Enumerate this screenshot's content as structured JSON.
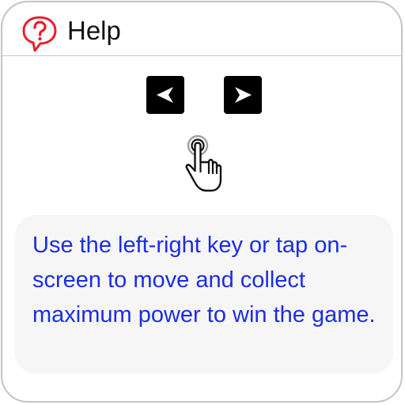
{
  "header": {
    "title": "Help",
    "icon": "question-speech-bubble-icon"
  },
  "controls": {
    "left_key_icon": "arrow-left-icon",
    "right_key_icon": "arrow-right-icon",
    "tap_icon": "tap-hand-icon"
  },
  "info": {
    "text": "Use the left-right key or tap on-screen to move and collect maximum power to win the game."
  },
  "colors": {
    "accent_red": "#e8202a",
    "info_text_blue": "#1c2ee0",
    "key_black": "#000000",
    "card_background": "#f6f6f6",
    "border_gray": "#c4c4c4"
  }
}
